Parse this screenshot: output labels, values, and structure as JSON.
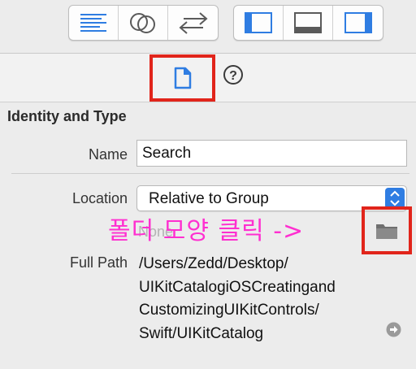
{
  "toolbar": {
    "editor_buttons": [
      {
        "name": "standard-editor-icon",
        "color": "#2f7de2"
      },
      {
        "name": "assistant-editor-icon",
        "color": "#5a5a5a"
      },
      {
        "name": "version-editor-icon",
        "color": "#5a5a5a"
      }
    ],
    "panel_buttons": [
      {
        "name": "navigator-panel-icon",
        "color": "#2f7de2"
      },
      {
        "name": "debug-area-icon",
        "color": "#5a5a5a"
      },
      {
        "name": "utilities-panel-icon",
        "color": "#2f7de2"
      }
    ]
  },
  "inspector_tabs": {
    "file_icon": "file-inspector-icon",
    "help_icon": "quick-help-icon",
    "help_glyph": "?"
  },
  "identity": {
    "section_title": "Identity and Type",
    "name_label": "Name",
    "name_value": "Search",
    "location_label": "Location",
    "location_value": "Relative to Group",
    "location_placeholder": "None",
    "full_path_label": "Full Path",
    "full_path_lines": [
      "/Users/Zedd/Desktop/",
      "UIKitCatalogiOSCreatingand",
      "CustomizingUIKitControls/",
      "Swift/UIKitCatalog"
    ],
    "folder_icon": "folder-icon",
    "reveal_icon": "reveal-in-finder-arrow-icon"
  },
  "annotation": {
    "text": "폴더 모양 클릭 ->",
    "color": "#ff2fd0",
    "highlight_color": "#e1251b"
  },
  "colors": {
    "accent": "#2f7de2",
    "background": "#ececec"
  }
}
